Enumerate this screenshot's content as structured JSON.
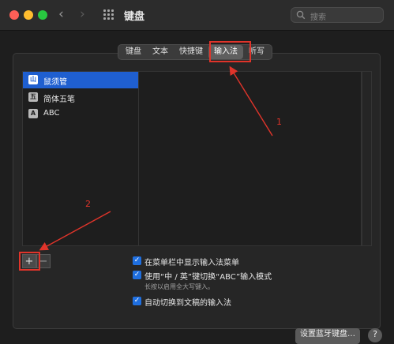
{
  "window": {
    "title": "键盘"
  },
  "search": {
    "placeholder": "搜索"
  },
  "tabs": [
    {
      "label": "键盘",
      "selected": false
    },
    {
      "label": "文本",
      "selected": false
    },
    {
      "label": "快捷键",
      "selected": false
    },
    {
      "label": "输入法",
      "selected": true
    },
    {
      "label": "听写",
      "selected": false
    }
  ],
  "input_sources": [
    {
      "icon_char": "山",
      "label": "鼠须管",
      "selected": true
    },
    {
      "icon_char": "五",
      "label": "简体五笔",
      "selected": false
    },
    {
      "icon_char": "A",
      "label": "ABC",
      "selected": false
    }
  ],
  "list_controls": {
    "add": "+",
    "remove": "−"
  },
  "options": [
    {
      "label": "在菜单栏中显示输入法菜单",
      "checked": true
    },
    {
      "label": "使用“中 / 英”键切换“ABC”输入模式",
      "checked": true
    },
    {
      "label": "自动切换到文稿的输入法",
      "checked": true
    }
  ],
  "options_note": "长按以启用全大写键入。",
  "footer": {
    "bluetooth_button": "设置蓝牙键盘…",
    "help": "?"
  },
  "annotations": {
    "one": "1",
    "two": "2"
  },
  "colors": {
    "accent": "#1f5fd0",
    "annotation": "#e0342a"
  }
}
